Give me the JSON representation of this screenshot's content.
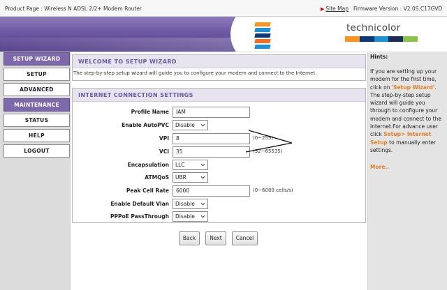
{
  "topbar": {
    "product_page": "Product Page : Wireless N ADSL 2/2+ Modem Router",
    "site_map": "Site Map",
    "firmware": "Firmware Version : V2.0S.C17GVD"
  },
  "brand": {
    "logo_text": "technicolor",
    "stripe_colors": [
      "#f7941d",
      "#0b3a78",
      "#1e90d6",
      "#1c2a5a",
      "#8bc34a"
    ]
  },
  "nav": {
    "items": [
      {
        "label": "SETUP WIZARD"
      },
      {
        "label": "SETUP"
      },
      {
        "label": "ADVANCED"
      },
      {
        "label": "MAINTENANCE"
      },
      {
        "label": "STATUS"
      },
      {
        "label": "HELP"
      },
      {
        "label": "LOGOUT"
      }
    ]
  },
  "welcome": {
    "title": "WELCOME TO SETUP WIZARD",
    "description": "The step-by-step setup wizard will guide you to configure your modem and connect to the Internet."
  },
  "internet": {
    "title": "INTERNET CONNECTION SETTINGS",
    "fields": {
      "profile_name": {
        "label": "Profile Name",
        "value": "IAM"
      },
      "autopvc": {
        "label": "Enable AutoPVC",
        "value": "Disable"
      },
      "vpi": {
        "label": "VPI",
        "value": "8",
        "hint": "(0~255)"
      },
      "vci": {
        "label": "VCI",
        "value": "35",
        "hint": "(32~65535)"
      },
      "encapsulation": {
        "label": "Encapsulation",
        "value": "LLC"
      },
      "atmqos": {
        "label": "ATMQoS",
        "value": "UBR"
      },
      "peak_cell_rate": {
        "label": "Peak Cell Rate",
        "value": "6000",
        "hint": "(0~6000 cells/s)"
      },
      "default_vlan": {
        "label": "Enable Default Vlan",
        "value": "Disable"
      },
      "pppoe_passthrough": {
        "label": "PPPoE PassThrough",
        "value": "Disable"
      }
    }
  },
  "buttons": {
    "back": "Back",
    "next": "Next",
    "cancel": "Cancel"
  },
  "hints": {
    "title": "Hints:",
    "p1": "If you are setting up your modem for the first time, click on ",
    "wizard_link": "'Setup Wizard'",
    "p2": ". The step-by-step setup wizard will guide you through to configure your modem and connect to the Internet.For advance user click ",
    "setup_link": "Setup> Internet Setup",
    "p3": " to manually enter settings.",
    "more": "More.."
  }
}
